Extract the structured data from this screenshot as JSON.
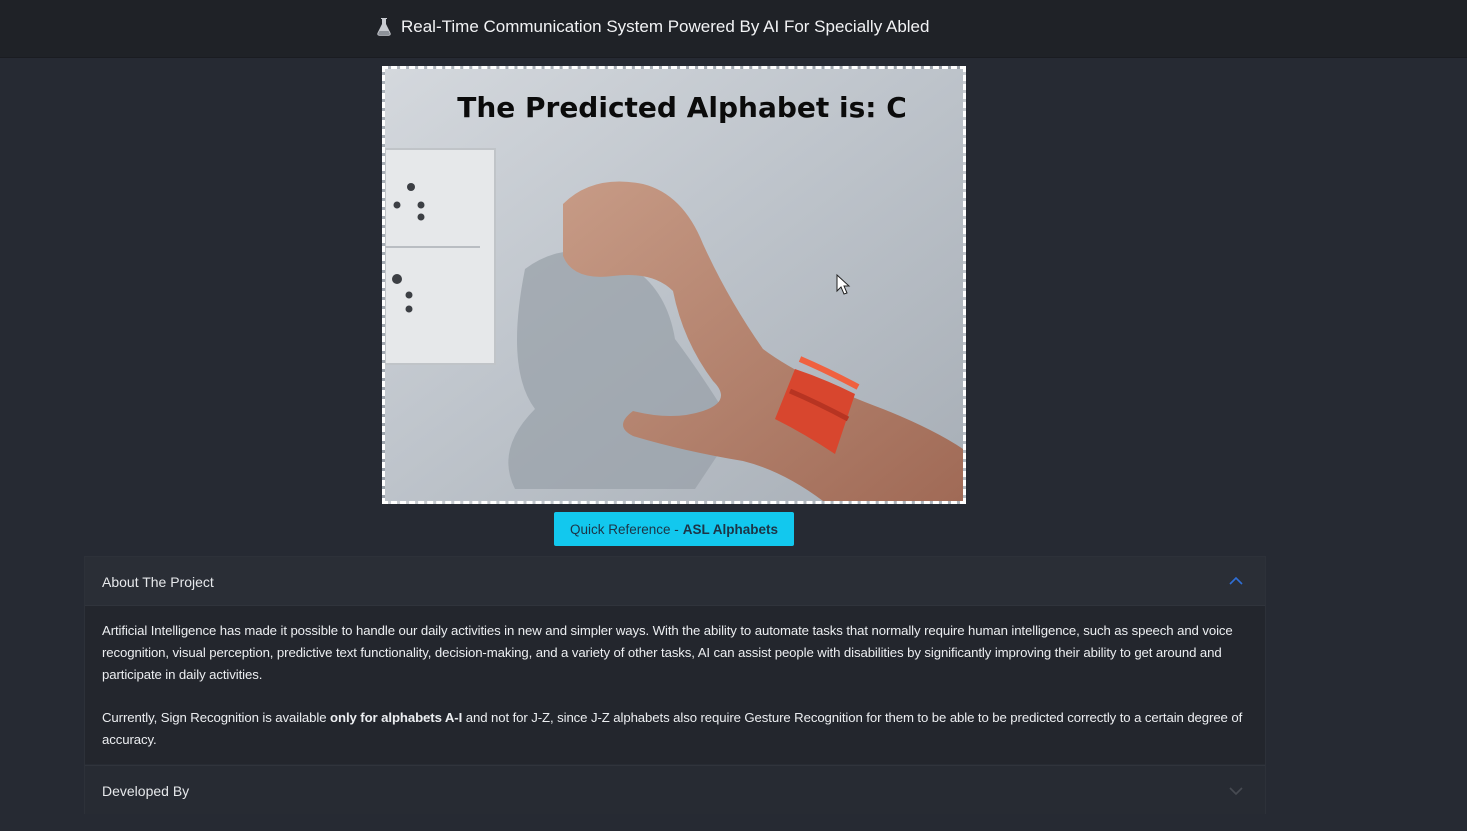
{
  "header": {
    "title": "Real-Time Communication System Powered By AI For Specially Abled",
    "icon": "flask-icon"
  },
  "video": {
    "overlay_text": "The Predicted Alphabet is: C"
  },
  "reference_button": {
    "label_prefix": "Quick Reference - ",
    "label_bold": "ASL Alphabets"
  },
  "accordion": {
    "about": {
      "title": "About The Project",
      "expanded": true,
      "paragraph1": "Artificial Intelligence has made it possible to handle our daily activities in new and simpler ways. With the ability to automate tasks that normally require human intelligence, such as speech and voice recognition, visual perception, predictive text functionality, decision-making, and a variety of other tasks, AI can assist people with disabilities by significantly improving their ability to get around and participate in daily activities.",
      "paragraph2_before": "Currently, Sign Recognition is available ",
      "paragraph2_bold": "only for alphabets A-I",
      "paragraph2_after": " and not for J-Z, since J-Z alphabets also require Gesture Recognition for them to be able to be predicted correctly to a certain degree of accuracy."
    },
    "developed_by": {
      "title": "Developed By",
      "expanded": false
    }
  },
  "colors": {
    "background": "#262a33",
    "navbar": "#1f2227",
    "button": "#12c8ee",
    "accent_chevron": "#2f6fd6"
  }
}
